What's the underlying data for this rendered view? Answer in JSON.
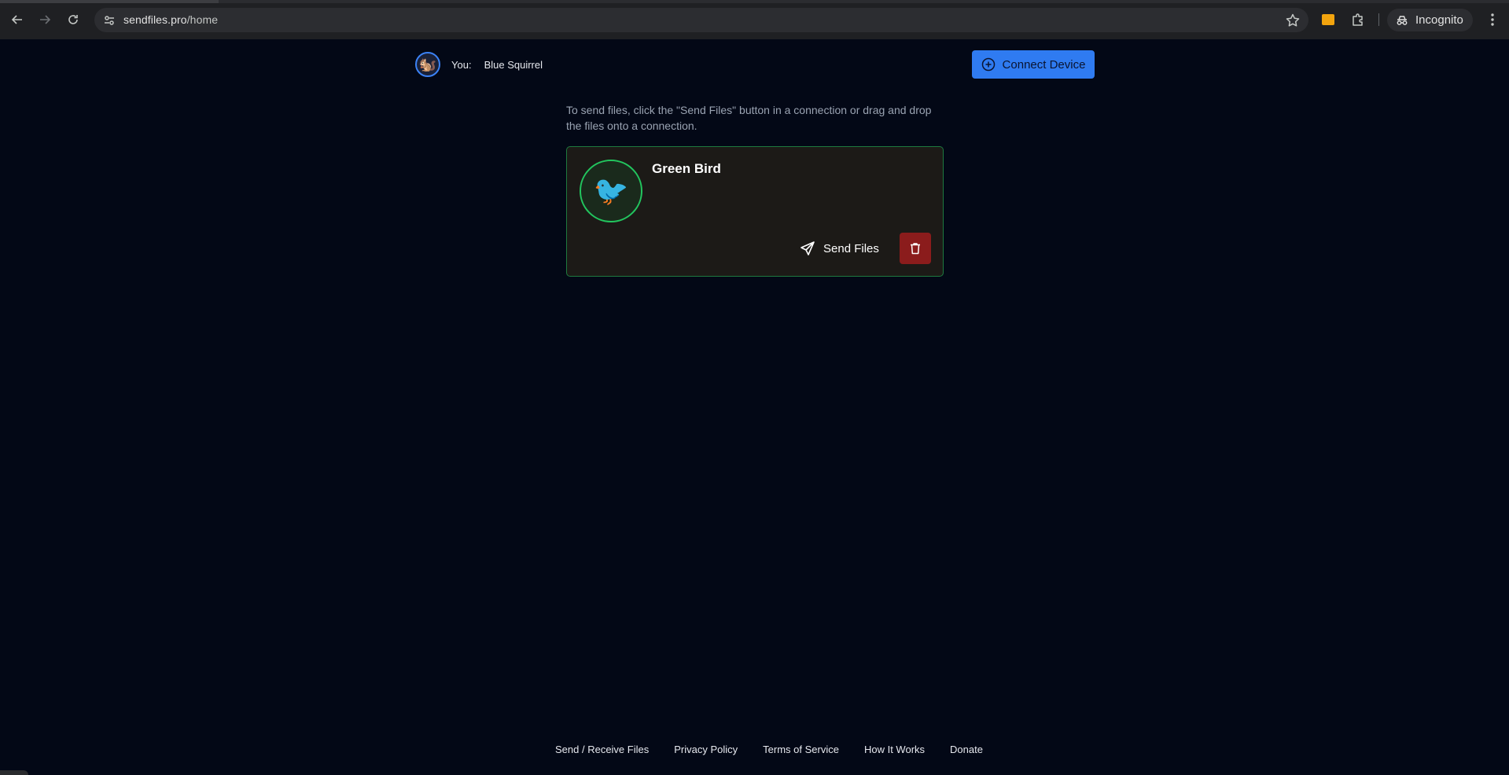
{
  "browser": {
    "url_host": "sendfiles.pro",
    "url_path": "/home",
    "profile_label": "Incognito",
    "icons": {
      "back": "arrow-left-icon",
      "forward": "arrow-right-icon",
      "reload": "reload-icon",
      "site_info": "tune-icon",
      "bookmark": "star-icon",
      "extension": "puzzle-icon",
      "menu": "kebab-menu-icon",
      "incognito": "incognito-icon"
    }
  },
  "header": {
    "you_label": "You:",
    "you_name": "Blue Squirrel",
    "you_avatar": "🐿️",
    "connect_button": "Connect Device"
  },
  "main": {
    "hint": "To send files, click the \"Send Files\" button in a connection or drag and drop the files onto a connection."
  },
  "connections": [
    {
      "name": "Green Bird",
      "avatar": "🐦",
      "send_label": "Send Files"
    }
  ],
  "footer": {
    "links": [
      "Send / Receive Files",
      "Privacy Policy",
      "Terms of Service",
      "How It Works",
      "Donate"
    ]
  },
  "colors": {
    "page_bg": "#030816",
    "accent_blue": "#2f7bf1",
    "connection_border": "#1e7a3f",
    "delete_red": "#8b1c1c"
  }
}
